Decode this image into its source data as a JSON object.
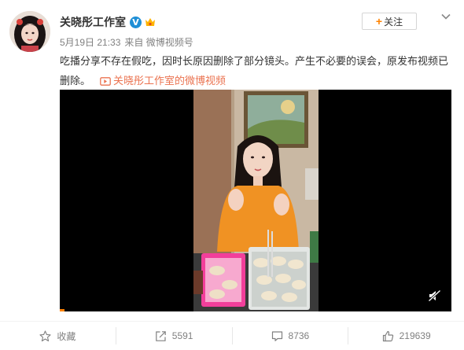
{
  "post": {
    "author": "关晓彤工作室",
    "verified_mark": "V",
    "date": "5月19日 21:33",
    "source": "来自 微博视频号",
    "text": "吃播分享不存在假吃，因时长原因删除了部分镜头。产生不必要的误会，原发布视频已删除。",
    "video_link": "关晓彤工作室的微博视频"
  },
  "follow": {
    "label": "关注",
    "plus": "+"
  },
  "video": {
    "progress": 0.012,
    "accent": "#ff8200"
  },
  "actions": {
    "favorite": "收藏",
    "repost": "5591",
    "comment": "8736",
    "like": "219639"
  },
  "colors": {
    "link": "#eb7350",
    "meta": "#808080",
    "text": "#333333",
    "verified": "#1f8fd6"
  },
  "icons": [
    "verified-icon",
    "member-badge-icon",
    "chevron-down-icon",
    "video-icon",
    "mute-icon",
    "star-icon",
    "repost-icon",
    "comment-icon",
    "thumbs-up-icon"
  ]
}
